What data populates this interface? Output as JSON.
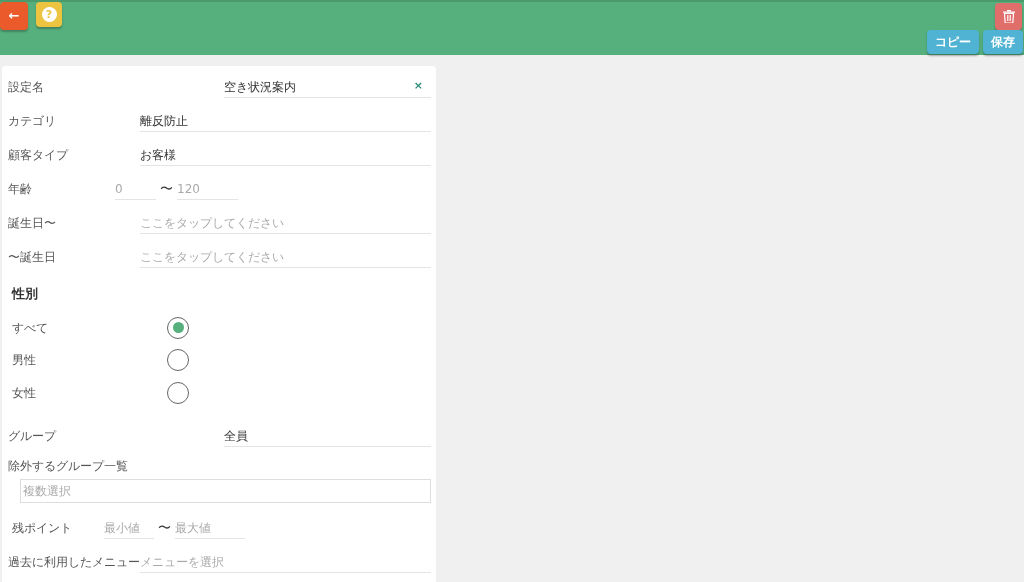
{
  "header": {
    "back_button": "←",
    "help_button": "?",
    "buttons": [
      {
        "label": "コピー"
      },
      {
        "label": "保存"
      }
    ]
  },
  "fields": [
    {
      "kind": "text",
      "label": "設定名",
      "value": "空き状況案内",
      "clear": "×"
    },
    {
      "kind": "picker",
      "label": "カテゴリ",
      "value": "離反防止"
    },
    {
      "kind": "picker",
      "label": "顧客タイプ",
      "value": "お客様"
    },
    {
      "kind": "range",
      "label": "年齢",
      "min": {
        "placeholder": "0"
      },
      "separator": "〜",
      "max": {
        "placeholder": "120"
      }
    },
    {
      "kind": "picker",
      "label": "誕生日〜",
      "placeholder": "ここをタップしてください"
    },
    {
      "kind": "picker",
      "label": "〜誕生日",
      "placeholder": "ここをタップしてください"
    }
  ],
  "gender": {
    "title": "性別",
    "options": [
      {
        "label": "すべて",
        "selected": true
      },
      {
        "label": "男性",
        "selected": false
      },
      {
        "label": "女性",
        "selected": false
      }
    ]
  },
  "fields_2": [
    {
      "kind": "text",
      "label": "グループ",
      "value": "全員"
    },
    {
      "kind": "multi",
      "label": "除外するグループ一覧",
      "placeholder": "複数選択"
    },
    {
      "kind": "range",
      "label": "残ポイント",
      "min": {
        "placeholder": "最小値"
      },
      "separator": "〜",
      "max": {
        "placeholder": "最大値"
      }
    },
    {
      "kind": "picker",
      "label": "過去に利用したメニュー",
      "placeholder": "メニューを選択"
    }
  ]
}
